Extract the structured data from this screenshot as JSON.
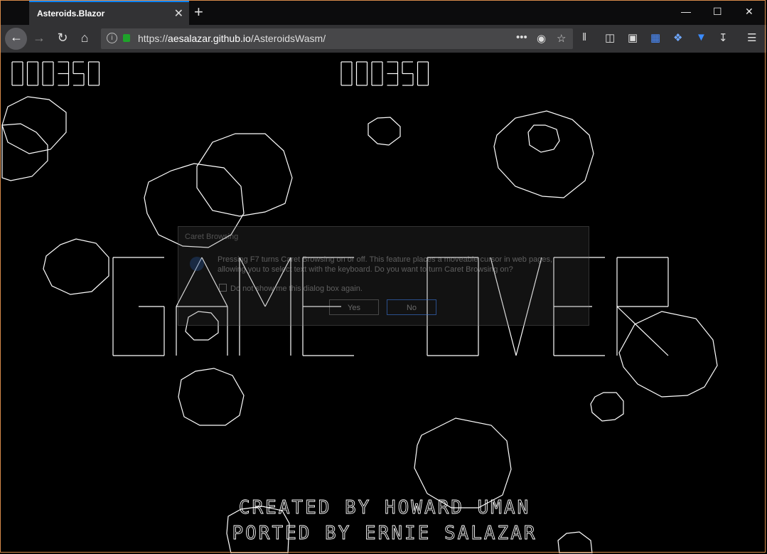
{
  "browser": {
    "tab_title": "Asteroids.Blazor",
    "tab_close": "✕",
    "new_tab": "+",
    "url_prefix": "https://",
    "url_host": "aesalazar.github.io",
    "url_path": "/AsteroidsWasm/",
    "url_more": "•••"
  },
  "game": {
    "score_left": "000350",
    "score_right": "000350",
    "title_word1": "GAME",
    "title_word2": "OVER",
    "credit1": "CREATED BY HOWARD UMAN",
    "credit2": "PORTED BY ERNIE SALAZAR"
  },
  "dialog": {
    "title": "Caret Browsing",
    "message": "Pressing F7 turns Caret Browsing on or off. This feature places a moveable cursor in web pages, allowing you to select text with the keyboard. Do you want to turn Caret Browsing on?",
    "checkbox": "Do not show me this dialog box again.",
    "yes": "Yes",
    "no": "No"
  },
  "colors": {
    "accent": "#0a84ff",
    "secure": "#1ea32a",
    "vector": "#ffffff"
  }
}
